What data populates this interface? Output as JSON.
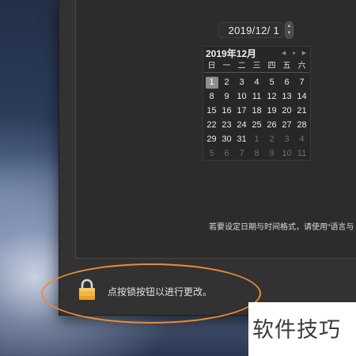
{
  "date_field": {
    "value": "2019/12/  1"
  },
  "calendar": {
    "title": "2019年12月",
    "nav": {
      "prev": "◀",
      "today": "●",
      "next": "▶"
    },
    "weekdays": [
      "日",
      "一",
      "二",
      "三",
      "四",
      "五",
      "六"
    ],
    "days": [
      "1",
      "2",
      "3",
      "4",
      "5",
      "6",
      "7",
      "8",
      "9",
      "10",
      "11",
      "12",
      "13",
      "14",
      "15",
      "16",
      "17",
      "18",
      "19",
      "20",
      "21",
      "22",
      "23",
      "24",
      "25",
      "26",
      "27",
      "28",
      "29",
      "30",
      "31",
      "1",
      "2",
      "3",
      "4",
      "5",
      "6",
      "7",
      "8",
      "9",
      "10",
      "11"
    ],
    "selected_day": "1"
  },
  "help_text": "若要设定日期与时间格式，请使用“语言与",
  "lock": {
    "label": "点按锁按钮以进行更改。"
  },
  "watermark": {
    "text": "软件技巧"
  },
  "colors": {
    "annotation": "#f08a33",
    "lock": "#f5b63e"
  }
}
